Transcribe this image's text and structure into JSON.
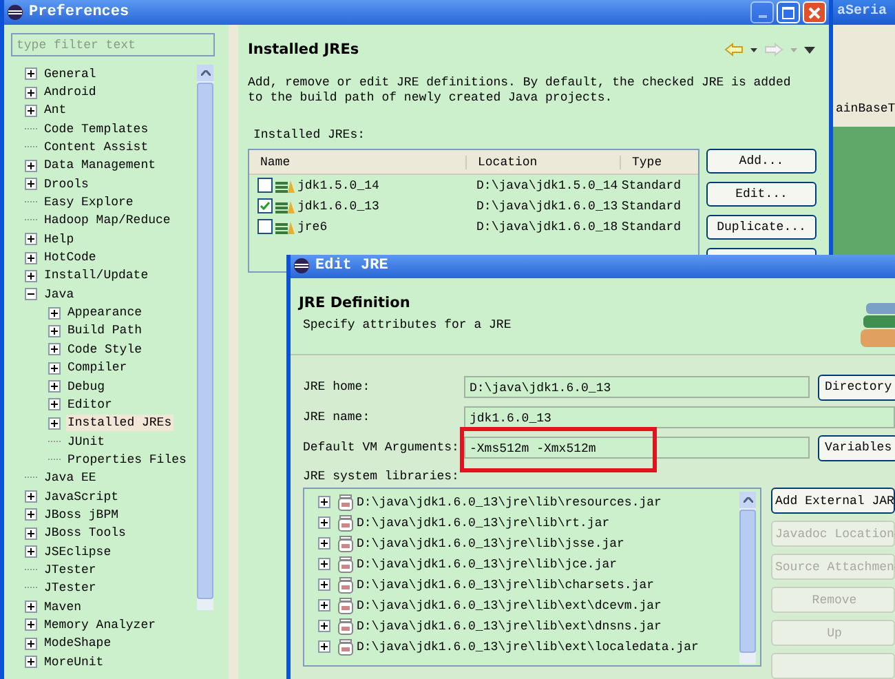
{
  "background_window": {
    "title": "aSeria",
    "text": "ainBaseT"
  },
  "preferences": {
    "title": "Preferences",
    "filter": {
      "placeholder": "type filter text"
    },
    "tree": [
      {
        "label": "General",
        "expanded": false,
        "selected": false
      },
      {
        "label": "Android",
        "expanded": false,
        "selected": false
      },
      {
        "label": "Ant",
        "expanded": false,
        "selected": false
      },
      {
        "label": "Code Templates",
        "selected": false
      },
      {
        "label": "Content Assist",
        "selected": false
      },
      {
        "label": "Data Management",
        "expanded": false,
        "selected": false
      },
      {
        "label": "Drools",
        "expanded": false,
        "selected": false
      },
      {
        "label": "Easy Explore",
        "selected": false
      },
      {
        "label": "Hadoop Map/Reduce",
        "selected": false
      },
      {
        "label": "Help",
        "expanded": false,
        "selected": false
      },
      {
        "label": "HotCode",
        "expanded": false,
        "selected": false
      },
      {
        "label": "Install/Update",
        "expanded": false,
        "selected": false
      },
      {
        "label": "Java",
        "expanded": true,
        "selected": false,
        "children": [
          {
            "label": "Appearance",
            "expanded": false,
            "selected": false
          },
          {
            "label": "Build Path",
            "expanded": false,
            "selected": false
          },
          {
            "label": "Code Style",
            "expanded": false,
            "selected": false
          },
          {
            "label": "Compiler",
            "expanded": false,
            "selected": false
          },
          {
            "label": "Debug",
            "expanded": false,
            "selected": false
          },
          {
            "label": "Editor",
            "expanded": false,
            "selected": false
          },
          {
            "label": "Installed JREs",
            "expanded": false,
            "selected": true
          },
          {
            "label": "JUnit",
            "selected": false
          },
          {
            "label": "Properties Files",
            "selected": false
          }
        ]
      },
      {
        "label": "Java EE",
        "selected": false
      },
      {
        "label": "JavaScript",
        "expanded": false,
        "selected": false
      },
      {
        "label": "JBoss jBPM",
        "expanded": false,
        "selected": false
      },
      {
        "label": "JBoss Tools",
        "expanded": false,
        "selected": false
      },
      {
        "label": "JSEclipse",
        "expanded": false,
        "selected": false
      },
      {
        "label": "JTester",
        "selected": false
      },
      {
        "label": "JTester",
        "selected": false
      },
      {
        "label": "Maven",
        "expanded": false,
        "selected": false
      },
      {
        "label": "Memory Analyzer",
        "expanded": false,
        "selected": false
      },
      {
        "label": "ModeShape",
        "expanded": false,
        "selected": false
      },
      {
        "label": "MoreUnit",
        "expanded": false,
        "selected": false
      }
    ],
    "page": {
      "title": "Installed JREs",
      "description": "Add, remove or edit JRE definitions. By default, the checked JRE is added to the build path of newly created Java projects.",
      "table_label": "Installed JREs:",
      "columns": [
        "Name",
        "Location",
        "Type"
      ],
      "rows": [
        {
          "name": "jdk1.5.0_14",
          "location": "D:\\java\\jdk1.5.0_14",
          "type": "Standard",
          "checked": false
        },
        {
          "name": "jdk1.6.0_13",
          "location": "D:\\java\\jdk1.6.0_13",
          "type": "Standard",
          "checked": true
        },
        {
          "name": "jre6",
          "location": "D:\\java\\jdk1.6.0_18",
          "type": "Standard",
          "checked": false
        }
      ],
      "buttons": [
        {
          "label": "Add..."
        },
        {
          "label": "Edit..."
        },
        {
          "label": "Duplicate..."
        }
      ]
    }
  },
  "edit_jre": {
    "title": "Edit JRE",
    "heading": "JRE Definition",
    "subtitle": "Specify attributes for a JRE",
    "fields": [
      {
        "label": "JRE home:",
        "value": "D:\\java\\jdk1.6.0_13",
        "button": "Directory"
      },
      {
        "label": "JRE name:",
        "value": "jdk1.6.0_13"
      },
      {
        "label": "Default VM Arguments:",
        "value": "-Xms512m -Xmx512m",
        "button": "Variables",
        "highlighted": true
      }
    ],
    "libraries_label": "JRE system libraries:",
    "libraries": [
      {
        "path": "D:\\java\\jdk1.6.0_13\\jre\\lib\\resources.jar",
        "expanded": false
      },
      {
        "path": "D:\\java\\jdk1.6.0_13\\jre\\lib\\rt.jar",
        "expanded": false
      },
      {
        "path": "D:\\java\\jdk1.6.0_13\\jre\\lib\\jsse.jar",
        "expanded": false
      },
      {
        "path": "D:\\java\\jdk1.6.0_13\\jre\\lib\\jce.jar",
        "expanded": false
      },
      {
        "path": "D:\\java\\jdk1.6.0_13\\jre\\lib\\charsets.jar",
        "expanded": false
      },
      {
        "path": "D:\\java\\jdk1.6.0_13\\jre\\lib\\ext\\dcevm.jar",
        "expanded": false
      },
      {
        "path": "D:\\java\\jdk1.6.0_13\\jre\\lib\\ext\\dnsns.jar",
        "expanded": false
      },
      {
        "path": "D:\\java\\jdk1.6.0_13\\jre\\lib\\ext\\localedata.jar",
        "expanded": false
      }
    ],
    "buttons": [
      {
        "label": "Add External JAR",
        "disabled": false
      },
      {
        "label": "Javadoc Location",
        "disabled": true
      },
      {
        "label": "Source Attachmen",
        "disabled": true
      },
      {
        "label": "Remove",
        "disabled": true
      },
      {
        "label": "Up",
        "disabled": true
      },
      {
        "disabled": true
      }
    ]
  }
}
